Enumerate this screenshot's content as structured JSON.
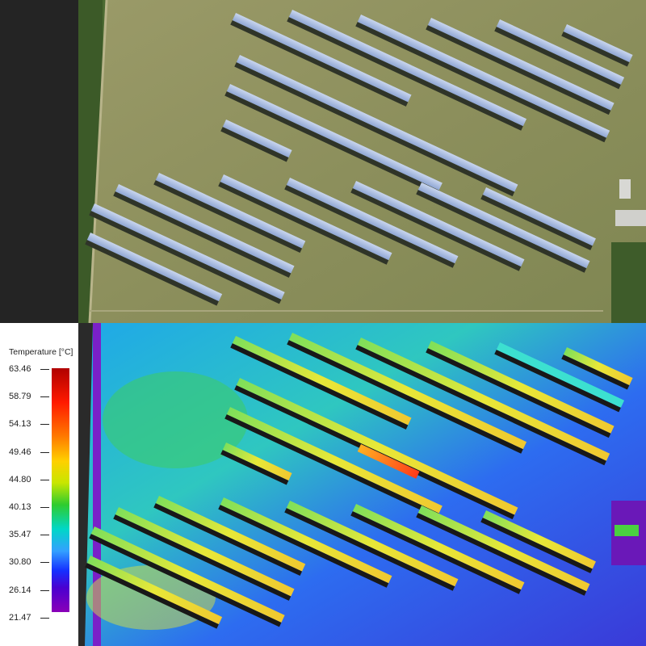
{
  "legend": {
    "title": "Temperature [°C]",
    "ticks": [
      "63.46",
      "58.79",
      "54.13",
      "49.46",
      "44.80",
      "40.13",
      "35.47",
      "30.80",
      "26.14",
      "21.47"
    ],
    "max_value": 63.46,
    "min_value": 21.47
  },
  "colors": {
    "rgb_grass": "#8f9260",
    "rgb_panel": "#9eb4dc",
    "thermal_ground": "#2d6cf0",
    "thermal_panel": "#e8e838",
    "hot_spot": "#ff3a1a"
  },
  "images": {
    "top": "rgb aerial photo of solar panel field",
    "bottom": "thermal infrared image of solar panel field"
  }
}
